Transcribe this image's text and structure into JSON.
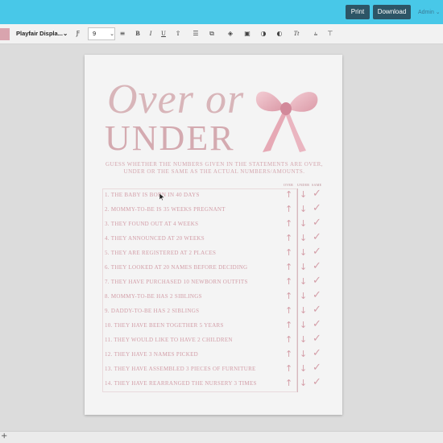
{
  "header": {
    "print_label": "Print",
    "download_label": "Download",
    "user_label": "Admin ⌄"
  },
  "toolbar": {
    "font_family": "Playfair Displa...⌄",
    "font_size": "9",
    "icons": [
      "text-style-icon",
      "chevron-down-icon",
      "line-spacing-icon",
      "bold-icon",
      "italic-icon",
      "underline-icon",
      "text-transform-icon",
      "duplicate-icon",
      "layers-icon",
      "lock-icon",
      "effects-icon",
      "font-icon",
      "clear-format-icon"
    ]
  },
  "document": {
    "title_line1": "Over or",
    "title_line2": "UNDER",
    "instructions": "GUESS WHETHER THE NUMBERS GIVEN IN THE STATEMENTS ARE OVER, UNDER OR THE SAME AS THE ACTUAL NUMBERS/AMOUNTS.",
    "columns": {
      "over": "OVER",
      "under": "UNDER",
      "same": "SAME"
    },
    "questions": [
      "1. THE BABY IS BORN IN 40 DAYS",
      "2. MOMMY-TO-BE IS 35 WEEKS PREGNANT",
      "3. THEY FOUND OUT AT 4 WEEKS",
      "4. THEY ANNOUNCED AT 20 WEEKS",
      "5. THEY ARE REGISTERED AT 2 PLACES",
      "6. THEY LOOKED AT 20 NAMES BEFORE DECIDING",
      "7. THEY HAVE PURCHASED 10 NEWBORN OUTFITS",
      "8. MOMMY-TO-BE HAS 2 SIBLINGS",
      "9. DADDY-TO-BE HAS 2 SIBLINGS",
      "10. THEY HAVE BEEN TOGETHER 5 YEARS",
      "11. THEY WOULD LIKE TO HAVE 2 CHILDREN",
      "12. THEY HAVE 3 NAMES PICKED",
      "13. THEY HAVE ASSEMBLED 3 PIECES OF FURNITURE",
      "14. THEY HAVE REARRANGED THE NURSERY 3 TIMES"
    ],
    "symbols": {
      "up": "↑",
      "down": "↓",
      "same": "✓"
    }
  },
  "footer": {
    "add_label": "+"
  },
  "colors": {
    "accent": "#48c8e8",
    "button": "#2d5566",
    "pink": "#d29da7"
  }
}
